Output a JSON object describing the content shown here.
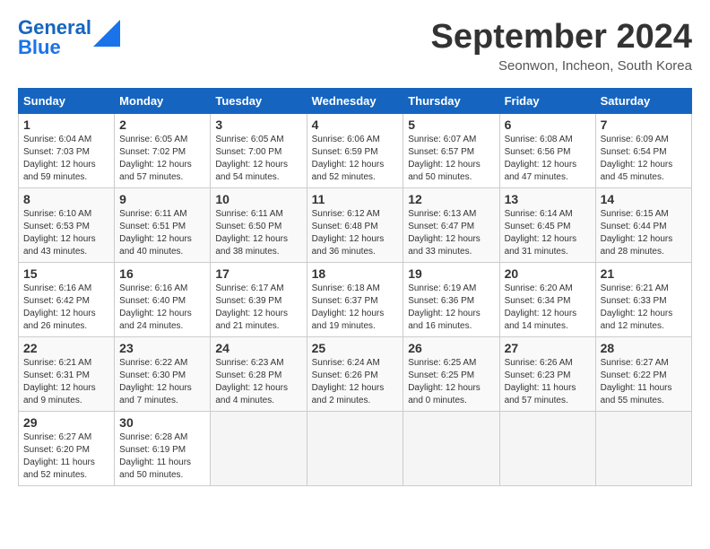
{
  "logo": {
    "part1": "General",
    "part2": "Blue"
  },
  "title": "September 2024",
  "location": "Seonwon, Incheon, South Korea",
  "headers": [
    "Sunday",
    "Monday",
    "Tuesday",
    "Wednesday",
    "Thursday",
    "Friday",
    "Saturday"
  ],
  "weeks": [
    [
      {
        "day": "1",
        "info": "Sunrise: 6:04 AM\nSunset: 7:03 PM\nDaylight: 12 hours\nand 59 minutes."
      },
      {
        "day": "2",
        "info": "Sunrise: 6:05 AM\nSunset: 7:02 PM\nDaylight: 12 hours\nand 57 minutes."
      },
      {
        "day": "3",
        "info": "Sunrise: 6:05 AM\nSunset: 7:00 PM\nDaylight: 12 hours\nand 54 minutes."
      },
      {
        "day": "4",
        "info": "Sunrise: 6:06 AM\nSunset: 6:59 PM\nDaylight: 12 hours\nand 52 minutes."
      },
      {
        "day": "5",
        "info": "Sunrise: 6:07 AM\nSunset: 6:57 PM\nDaylight: 12 hours\nand 50 minutes."
      },
      {
        "day": "6",
        "info": "Sunrise: 6:08 AM\nSunset: 6:56 PM\nDaylight: 12 hours\nand 47 minutes."
      },
      {
        "day": "7",
        "info": "Sunrise: 6:09 AM\nSunset: 6:54 PM\nDaylight: 12 hours\nand 45 minutes."
      }
    ],
    [
      {
        "day": "8",
        "info": "Sunrise: 6:10 AM\nSunset: 6:53 PM\nDaylight: 12 hours\nand 43 minutes."
      },
      {
        "day": "9",
        "info": "Sunrise: 6:11 AM\nSunset: 6:51 PM\nDaylight: 12 hours\nand 40 minutes."
      },
      {
        "day": "10",
        "info": "Sunrise: 6:11 AM\nSunset: 6:50 PM\nDaylight: 12 hours\nand 38 minutes."
      },
      {
        "day": "11",
        "info": "Sunrise: 6:12 AM\nSunset: 6:48 PM\nDaylight: 12 hours\nand 36 minutes."
      },
      {
        "day": "12",
        "info": "Sunrise: 6:13 AM\nSunset: 6:47 PM\nDaylight: 12 hours\nand 33 minutes."
      },
      {
        "day": "13",
        "info": "Sunrise: 6:14 AM\nSunset: 6:45 PM\nDaylight: 12 hours\nand 31 minutes."
      },
      {
        "day": "14",
        "info": "Sunrise: 6:15 AM\nSunset: 6:44 PM\nDaylight: 12 hours\nand 28 minutes."
      }
    ],
    [
      {
        "day": "15",
        "info": "Sunrise: 6:16 AM\nSunset: 6:42 PM\nDaylight: 12 hours\nand 26 minutes."
      },
      {
        "day": "16",
        "info": "Sunrise: 6:16 AM\nSunset: 6:40 PM\nDaylight: 12 hours\nand 24 minutes."
      },
      {
        "day": "17",
        "info": "Sunrise: 6:17 AM\nSunset: 6:39 PM\nDaylight: 12 hours\nand 21 minutes."
      },
      {
        "day": "18",
        "info": "Sunrise: 6:18 AM\nSunset: 6:37 PM\nDaylight: 12 hours\nand 19 minutes."
      },
      {
        "day": "19",
        "info": "Sunrise: 6:19 AM\nSunset: 6:36 PM\nDaylight: 12 hours\nand 16 minutes."
      },
      {
        "day": "20",
        "info": "Sunrise: 6:20 AM\nSunset: 6:34 PM\nDaylight: 12 hours\nand 14 minutes."
      },
      {
        "day": "21",
        "info": "Sunrise: 6:21 AM\nSunset: 6:33 PM\nDaylight: 12 hours\nand 12 minutes."
      }
    ],
    [
      {
        "day": "22",
        "info": "Sunrise: 6:21 AM\nSunset: 6:31 PM\nDaylight: 12 hours\nand 9 minutes."
      },
      {
        "day": "23",
        "info": "Sunrise: 6:22 AM\nSunset: 6:30 PM\nDaylight: 12 hours\nand 7 minutes."
      },
      {
        "day": "24",
        "info": "Sunrise: 6:23 AM\nSunset: 6:28 PM\nDaylight: 12 hours\nand 4 minutes."
      },
      {
        "day": "25",
        "info": "Sunrise: 6:24 AM\nSunset: 6:26 PM\nDaylight: 12 hours\nand 2 minutes."
      },
      {
        "day": "26",
        "info": "Sunrise: 6:25 AM\nSunset: 6:25 PM\nDaylight: 12 hours\nand 0 minutes."
      },
      {
        "day": "27",
        "info": "Sunrise: 6:26 AM\nSunset: 6:23 PM\nDaylight: 11 hours\nand 57 minutes."
      },
      {
        "day": "28",
        "info": "Sunrise: 6:27 AM\nSunset: 6:22 PM\nDaylight: 11 hours\nand 55 minutes."
      }
    ],
    [
      {
        "day": "29",
        "info": "Sunrise: 6:27 AM\nSunset: 6:20 PM\nDaylight: 11 hours\nand 52 minutes."
      },
      {
        "day": "30",
        "info": "Sunrise: 6:28 AM\nSunset: 6:19 PM\nDaylight: 11 hours\nand 50 minutes."
      },
      {
        "day": "",
        "info": ""
      },
      {
        "day": "",
        "info": ""
      },
      {
        "day": "",
        "info": ""
      },
      {
        "day": "",
        "info": ""
      },
      {
        "day": "",
        "info": ""
      }
    ]
  ]
}
